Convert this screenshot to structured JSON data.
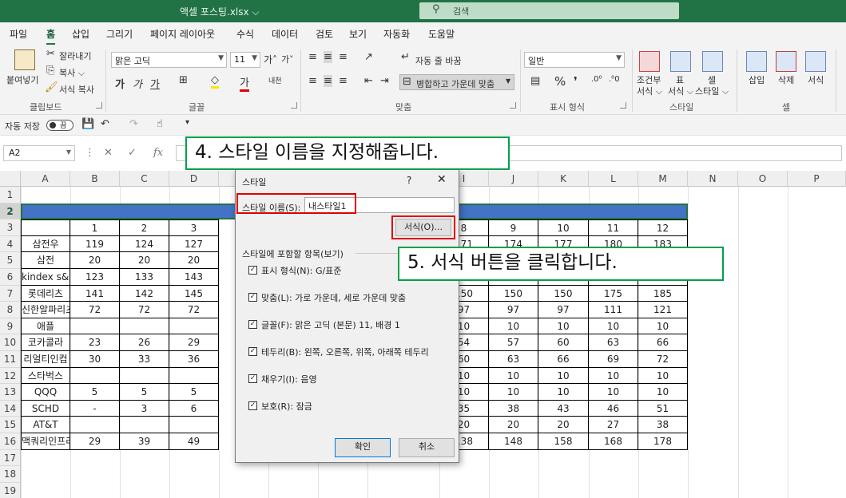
{
  "window": {
    "doc_title": "액셀 포스팅.xlsx ⌵",
    "search_placeholder": "검색"
  },
  "tabs": [
    "파일",
    "홈",
    "삽입",
    "그리기",
    "페이지 레이아웃",
    "수식",
    "데이터",
    "검토",
    "보기",
    "자동화",
    "도움말"
  ],
  "ribbon": {
    "paste": "붙여넣기",
    "cut": "잘라내기",
    "copy": "복사 ⌵",
    "format_painter": "서식 복사",
    "clipboard": "클립보드",
    "font_name": "맑은 고딕",
    "font_size": "11",
    "font_group": "글꼴",
    "wrap_text": "자동 줄 바꿈",
    "merge_center": "병합하고 가운데 맞춤",
    "alignment_group": "맞춤",
    "number_format": "일반",
    "number_group": "표시 형식",
    "cond_format": [
      "조건부",
      "서식 ⌵"
    ],
    "table_format": [
      "표",
      "서식 ⌵"
    ],
    "cell_style": [
      "셀",
      "스타일 ⌵"
    ],
    "style_group": "스타일",
    "insert": "삽입",
    "delete": "삭제",
    "format": "서식",
    "cells_group": "셀"
  },
  "qat": {
    "autosave": "자동 저장",
    "toggle": "끔"
  },
  "formula_bar": {
    "name_box": "A2",
    "fx": "fx"
  },
  "grid": {
    "columns": [
      "A",
      "B",
      "C",
      "D",
      "E",
      "F",
      "G",
      "H",
      "I",
      "J",
      "K",
      "L",
      "M",
      "N",
      "O",
      "P"
    ],
    "rows": [
      "1",
      "2",
      "3",
      "4",
      "5",
      "6",
      "7",
      "8",
      "9",
      "10",
      "11",
      "12",
      "13",
      "14",
      "15",
      "16",
      "17",
      "18",
      "19"
    ],
    "col_a": [
      "",
      "",
      "",
      "삼전우",
      "삼전",
      "kindex s&p",
      "롯데리츠",
      "신한알파리츠",
      "애플",
      "코카콜라",
      "리얼티인컴",
      "스타벅스",
      "QQQ",
      "SCHD",
      "AT&T",
      "맥쿼리인프라"
    ],
    "col_b": [
      "",
      "",
      "1",
      "119",
      "20",
      "123",
      "141",
      "72",
      "",
      "23",
      "30",
      "",
      "5",
      "-",
      "",
      "29"
    ],
    "col_c": [
      "",
      "",
      "2",
      "124",
      "20",
      "133",
      "142",
      "72",
      "",
      "26",
      "33",
      "",
      "5",
      "3",
      "",
      "39"
    ],
    "col_d": [
      "",
      "",
      "3",
      "127",
      "20",
      "143",
      "145",
      "72",
      "",
      "29",
      "36",
      "",
      "5",
      "6",
      "",
      "49"
    ],
    "col_i": [
      "",
      "",
      "8",
      "171",
      "",
      "",
      "150",
      "97",
      "10",
      "54",
      "60",
      "10",
      "10",
      "35",
      "20",
      "138"
    ],
    "col_j": [
      "",
      "",
      "9",
      "174",
      "",
      "",
      "150",
      "97",
      "10",
      "57",
      "63",
      "10",
      "10",
      "38",
      "20",
      "148"
    ],
    "col_k": [
      "",
      "",
      "10",
      "177",
      "",
      "",
      "150",
      "97",
      "10",
      "60",
      "66",
      "10",
      "10",
      "43",
      "20",
      "158"
    ],
    "col_l": [
      "",
      "",
      "11",
      "180",
      "",
      "",
      "175",
      "111",
      "10",
      "63",
      "69",
      "10",
      "10",
      "46",
      "27",
      "168"
    ],
    "col_m": [
      "",
      "",
      "12",
      "183",
      "",
      "",
      "185",
      "121",
      "10",
      "66",
      "72",
      "10",
      "10",
      "51",
      "38",
      "178"
    ]
  },
  "dialog": {
    "title": "스타일",
    "help": "?",
    "close": "✕",
    "name_label": "스타일 이름(S):",
    "name_value": "내스타일1",
    "format_button": "서식(O)...",
    "includes_label": "스타일에 포함할 항목(보기)",
    "options": [
      "표시 형식(N): G/표준",
      "맞춤(L): 가로 가운데, 세로 가운데 맞춤",
      "글꼴(F): 맑은 고딕 (본문) 11, 배경 1",
      "테두리(B): 왼쪽, 오른쪽, 위쪽, 아래쪽 테두리",
      "채우기(I): 음영",
      "보호(R): 잠금"
    ],
    "ok": "확인",
    "cancel": "취소"
  },
  "callouts": {
    "step4": "4. 스타일 이름을 지정해줍니다.",
    "step5": "5. 서식 버튼을 클릭합니다."
  },
  "colors": {
    "excel_green": "#217346",
    "header_fill": "#4472c4",
    "annotation_red": "#e00000",
    "callout_green": "#00a04a"
  }
}
